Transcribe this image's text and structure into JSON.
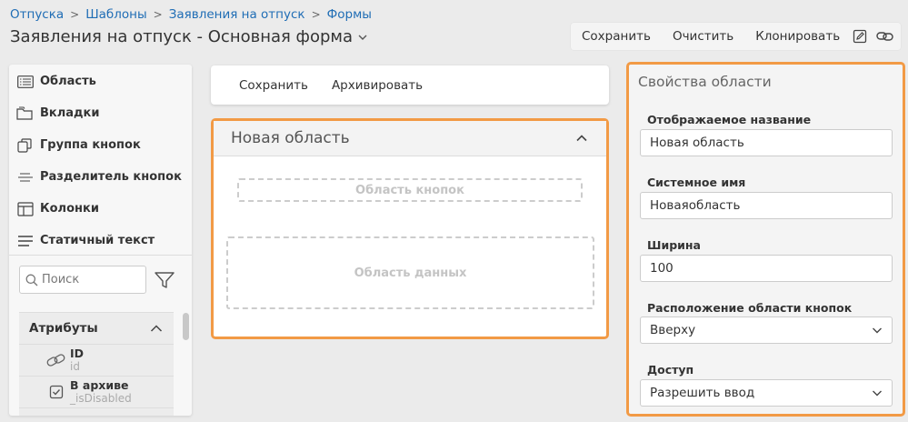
{
  "breadcrumb": [
    "Отпуска",
    "Шаблоны",
    "Заявления на отпуск",
    "Формы"
  ],
  "page_title": "Заявления на отпуск - Основная форма",
  "toolbar": {
    "save": "Сохранить",
    "clear": "Очистить",
    "clone": "Клонировать",
    "icons": [
      "edit-icon",
      "link-icon"
    ]
  },
  "toolbox": {
    "items": [
      {
        "label": "Область",
        "icon": "list-icon"
      },
      {
        "label": "Вкладки",
        "icon": "folder-icon"
      },
      {
        "label": "Группа кнопок",
        "icon": "copy-icon"
      },
      {
        "label": "Разделитель кнопок",
        "icon": "separator-icon"
      },
      {
        "label": "Колонки",
        "icon": "columns-icon"
      },
      {
        "label": "Статичный текст",
        "icon": "text-lines-icon"
      }
    ],
    "search_placeholder": "Поиск"
  },
  "attributes": {
    "title": "Атрибуты",
    "items": [
      {
        "name": "ID",
        "system": "id",
        "icon": "link-icon"
      },
      {
        "name": "В архиве",
        "system": "_isDisabled",
        "icon": "checkbox-icon"
      }
    ]
  },
  "center": {
    "actions": [
      "Сохранить",
      "Архивировать"
    ],
    "region_title": "Новая область",
    "button_area": "Область кнопок",
    "data_area": "Область данных"
  },
  "properties": {
    "title": "Свойства области",
    "display_name_label": "Отображаемое название",
    "display_name_value": "Новая область",
    "system_name_label": "Системное имя",
    "system_name_value": "Новаяобласть",
    "width_label": "Ширина",
    "width_value": "100",
    "button_position_label": "Расположение области кнопок",
    "button_position_value": "Вверху",
    "access_label": "Доступ",
    "access_value": "Разрешить ввод"
  },
  "colors": {
    "accent_orange": "#f29a45",
    "link_blue": "#1f6db5"
  }
}
